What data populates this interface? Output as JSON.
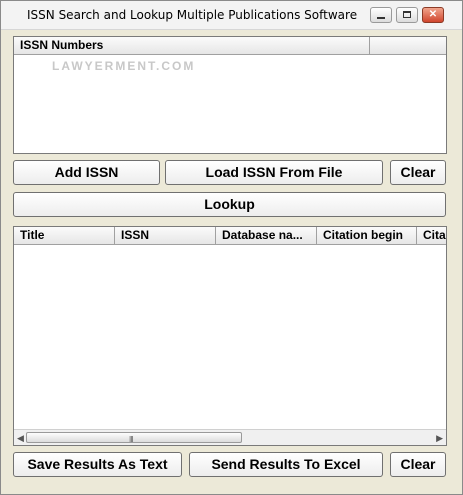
{
  "window": {
    "title": "ISSN Search and Lookup Multiple Publications Software",
    "controls": [
      "minimize-icon",
      "maximize-icon",
      "close-icon"
    ]
  },
  "issn_list": {
    "header": "ISSN Numbers",
    "watermark": "LAWYERMENT.COM"
  },
  "buttons": {
    "add_issn": "Add ISSN",
    "load_file": "Load ISSN From File",
    "clear_top": "Clear",
    "lookup": "Lookup",
    "save_text": "Save Results As Text",
    "send_excel": "Send Results To Excel",
    "clear_bottom": "Clear"
  },
  "results_table": {
    "columns": [
      "Title",
      "ISSN",
      "Database na...",
      "Citation begin",
      "Cita"
    ]
  },
  "scrollbar": {
    "left_icon": "left-arrow-icon",
    "right_icon": "right-arrow-icon",
    "grip": "III"
  }
}
